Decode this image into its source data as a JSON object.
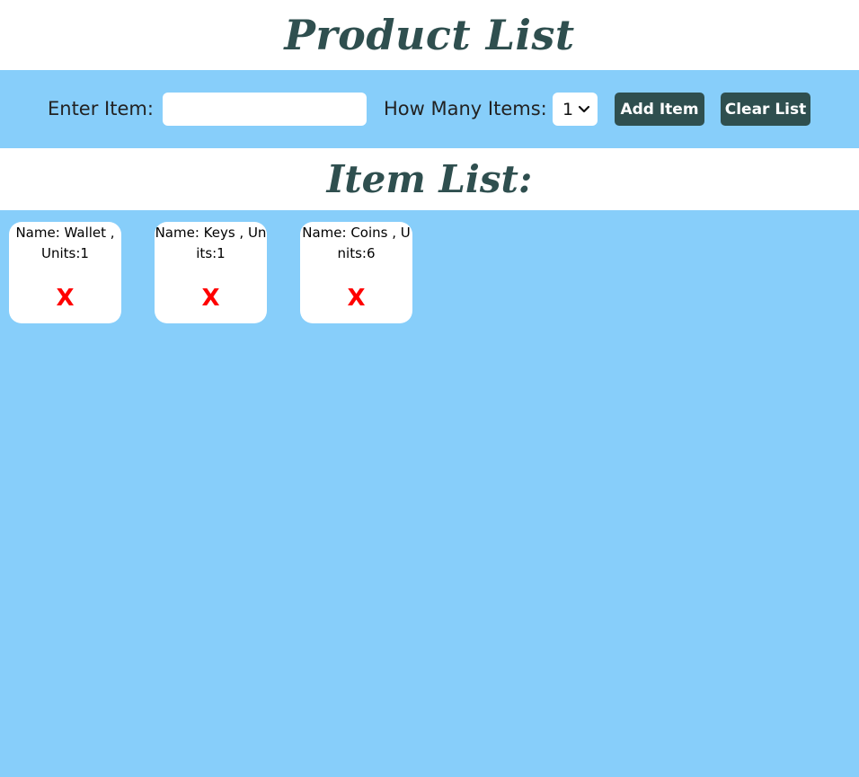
{
  "header": {
    "title": "Product List"
  },
  "form": {
    "enter_item_label": "Enter Item:",
    "item_input_value": "",
    "how_many_label": "How Many Items:",
    "quantity_selected": "1",
    "add_button": "Add Item",
    "clear_button": "Clear List"
  },
  "list": {
    "title": "Item List:",
    "items": [
      {
        "text": "Name: Wallet , Units:1",
        "delete": "X"
      },
      {
        "text": "Name: Keys , Units:1",
        "delete": "X"
      },
      {
        "text": "Name: Coins , Units:6",
        "delete": "X"
      }
    ]
  },
  "colors": {
    "background": "#87cefa",
    "heading": "#2f4f4f",
    "button": "#2f4f4f",
    "delete": "#ff0000"
  },
  "icons": {
    "select_arrow": "chevron-down-icon"
  }
}
